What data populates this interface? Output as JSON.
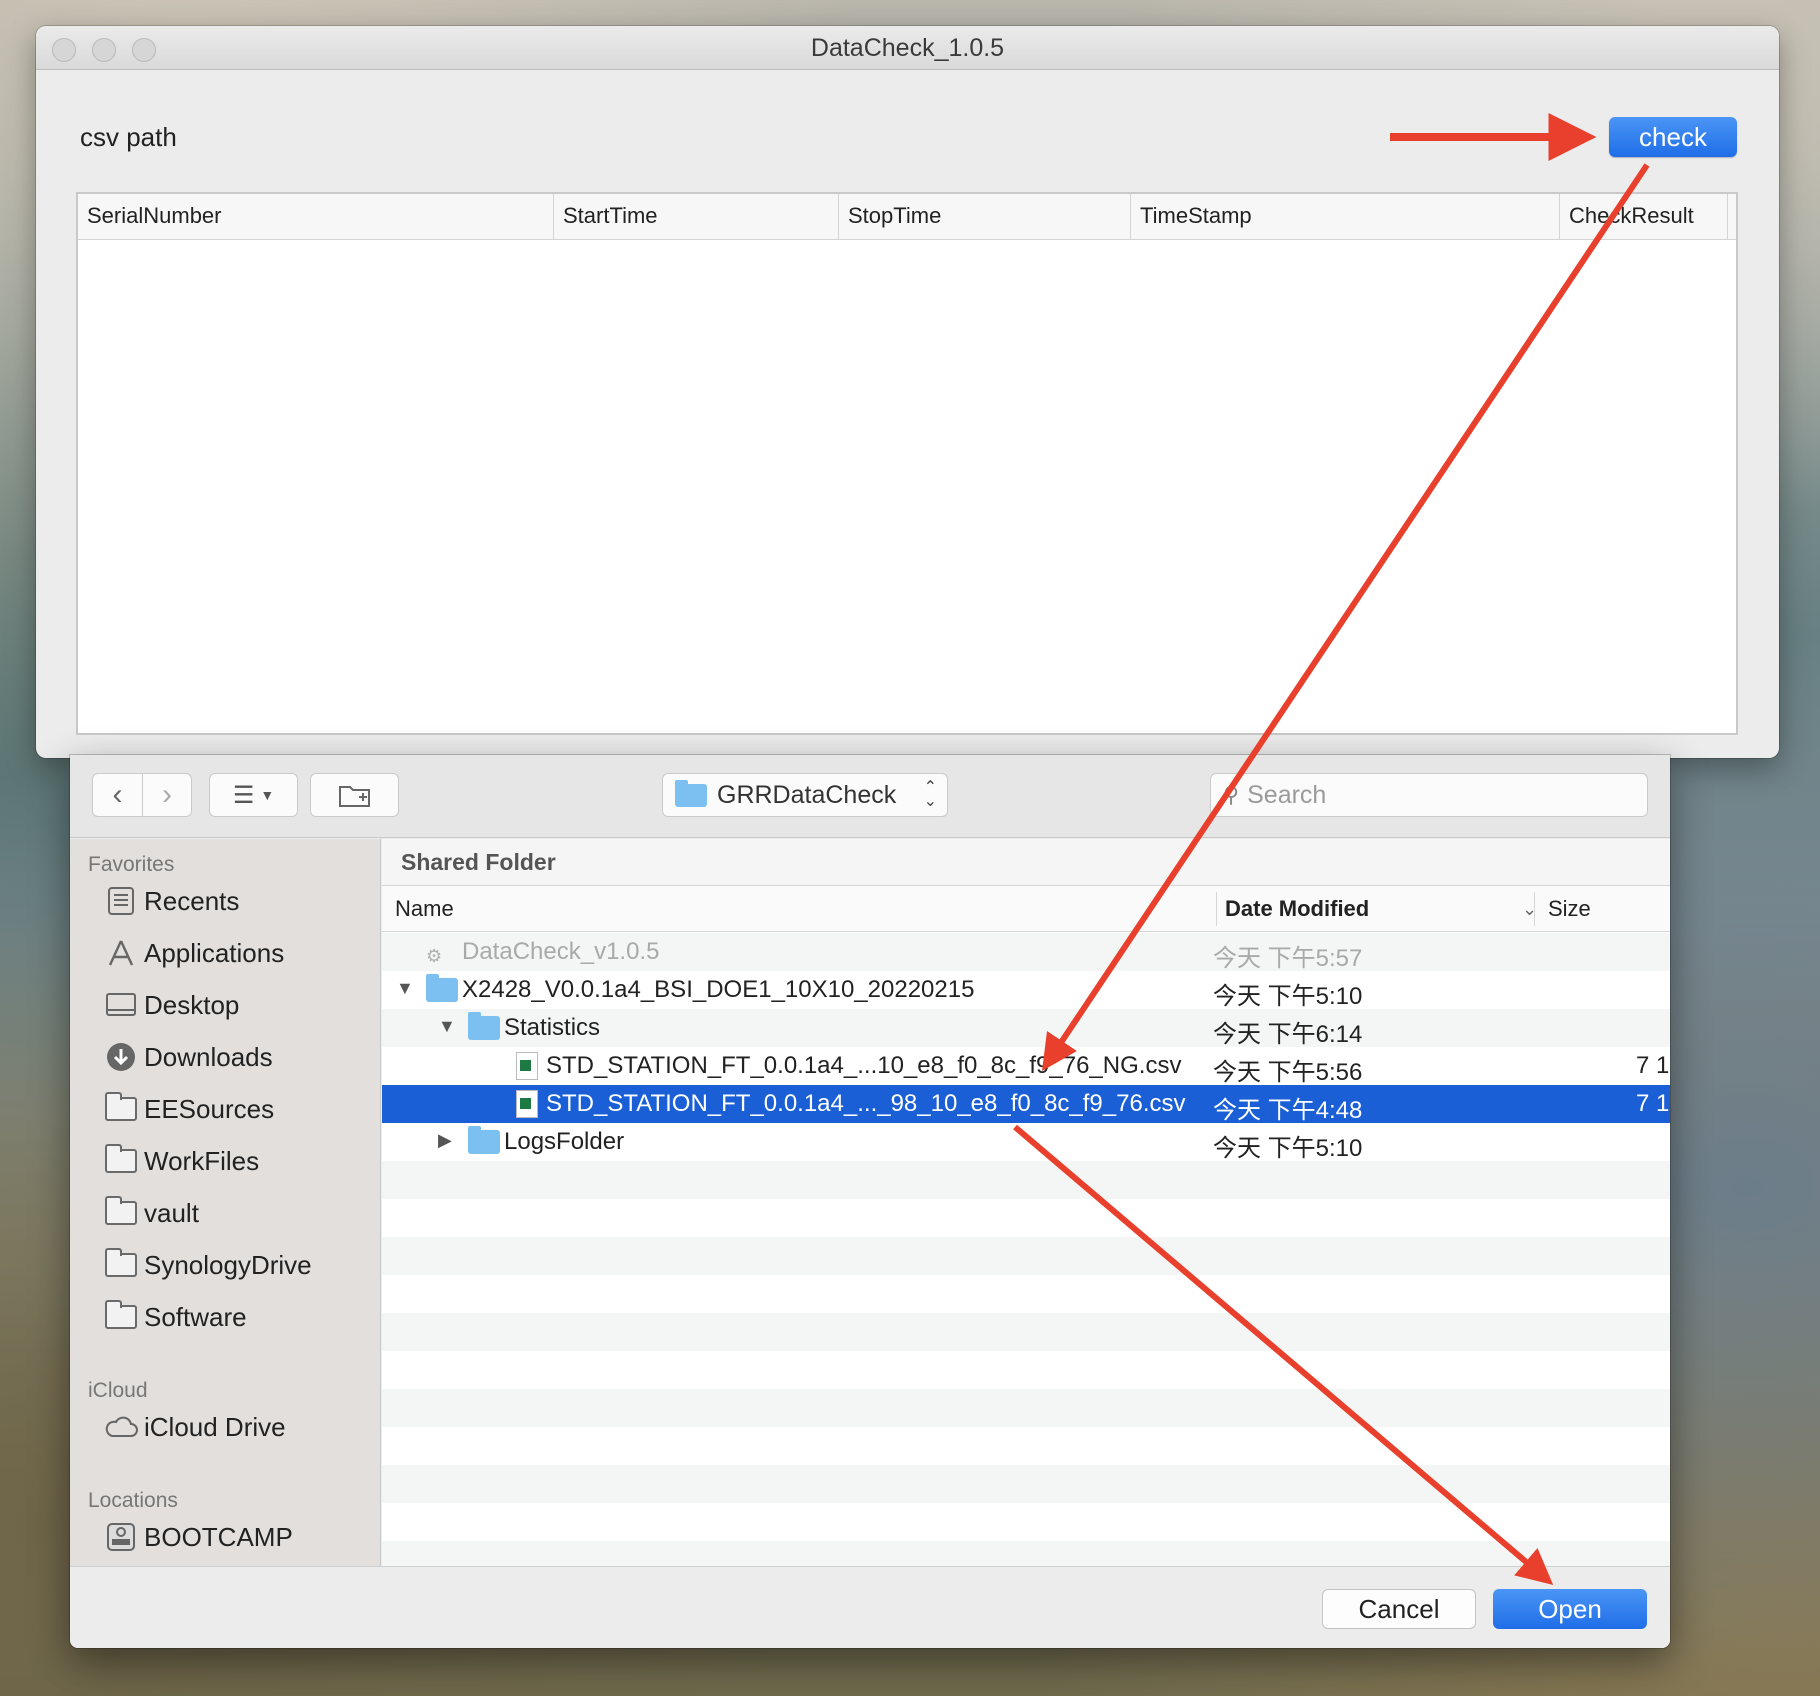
{
  "main_window": {
    "title": "DataCheck_1.0.5",
    "csv_label": "csv path",
    "check_label": "check",
    "columns": [
      "SerialNumber",
      "StartTime",
      "StopTime",
      "TimeStamp",
      "CheckResult"
    ]
  },
  "dialog": {
    "path_popup": "GRRDataCheck",
    "search_placeholder": "Search",
    "sidebar": {
      "favorites_heading": "Favorites",
      "favorites": [
        {
          "label": "Recents",
          "icon": "recents-icon"
        },
        {
          "label": "Applications",
          "icon": "applications-icon"
        },
        {
          "label": "Desktop",
          "icon": "desktop-icon"
        },
        {
          "label": "Downloads",
          "icon": "downloads-icon"
        },
        {
          "label": "EESources",
          "icon": "folder-icon"
        },
        {
          "label": "WorkFiles",
          "icon": "folder-icon"
        },
        {
          "label": "vault",
          "icon": "folder-icon"
        },
        {
          "label": "SynologyDrive",
          "icon": "folder-icon"
        },
        {
          "label": "Software",
          "icon": "folder-icon"
        }
      ],
      "icloud_heading": "iCloud",
      "icloud": [
        {
          "label": "iCloud Drive",
          "icon": "cloud-icon"
        }
      ],
      "locations_heading": "Locations",
      "locations": [
        {
          "label": "BOOTCAMP",
          "icon": "disk-icon"
        }
      ]
    },
    "browser": {
      "section_title": "Shared Folder",
      "col_name": "Name",
      "col_date": "Date Modified",
      "col_size": "Size",
      "rows": [
        {
          "name": "DataCheck_v1.0.5",
          "date": "今天 下午5:57",
          "size": "",
          "kind": "app",
          "depth": 0,
          "disclosure": "",
          "state": "disabled"
        },
        {
          "name": "X2428_V0.0.1a4_BSI_DOE1_10X10_20220215",
          "date": "今天 下午5:10",
          "size": "",
          "kind": "folder",
          "depth": 0,
          "disclosure": "expanded",
          "state": "normal"
        },
        {
          "name": "Statistics",
          "date": "今天 下午6:14",
          "size": "",
          "kind": "folder",
          "depth": 1,
          "disclosure": "expanded",
          "state": "normal"
        },
        {
          "name": "STD_STATION_FT_0.0.1a4_...10_e8_f0_8c_f9_76_NG.csv",
          "date": "今天 下午5:56",
          "size": "7 1",
          "kind": "csv",
          "depth": 2,
          "disclosure": "",
          "state": "normal"
        },
        {
          "name": "STD_STATION_FT_0.0.1a4_..._98_10_e8_f0_8c_f9_76.csv",
          "date": "今天 下午4:48",
          "size": "7 1",
          "kind": "csv",
          "depth": 2,
          "disclosure": "",
          "state": "selected"
        },
        {
          "name": "LogsFolder",
          "date": "今天 下午5:10",
          "size": "",
          "kind": "folder",
          "depth": 1,
          "disclosure": "collapsed",
          "state": "normal"
        }
      ]
    },
    "cancel_label": "Cancel",
    "open_label": "Open"
  },
  "colors": {
    "accent": "#1f6ee8",
    "selection": "#1a5fd6",
    "annotation_arrow": "#e8402c"
  }
}
